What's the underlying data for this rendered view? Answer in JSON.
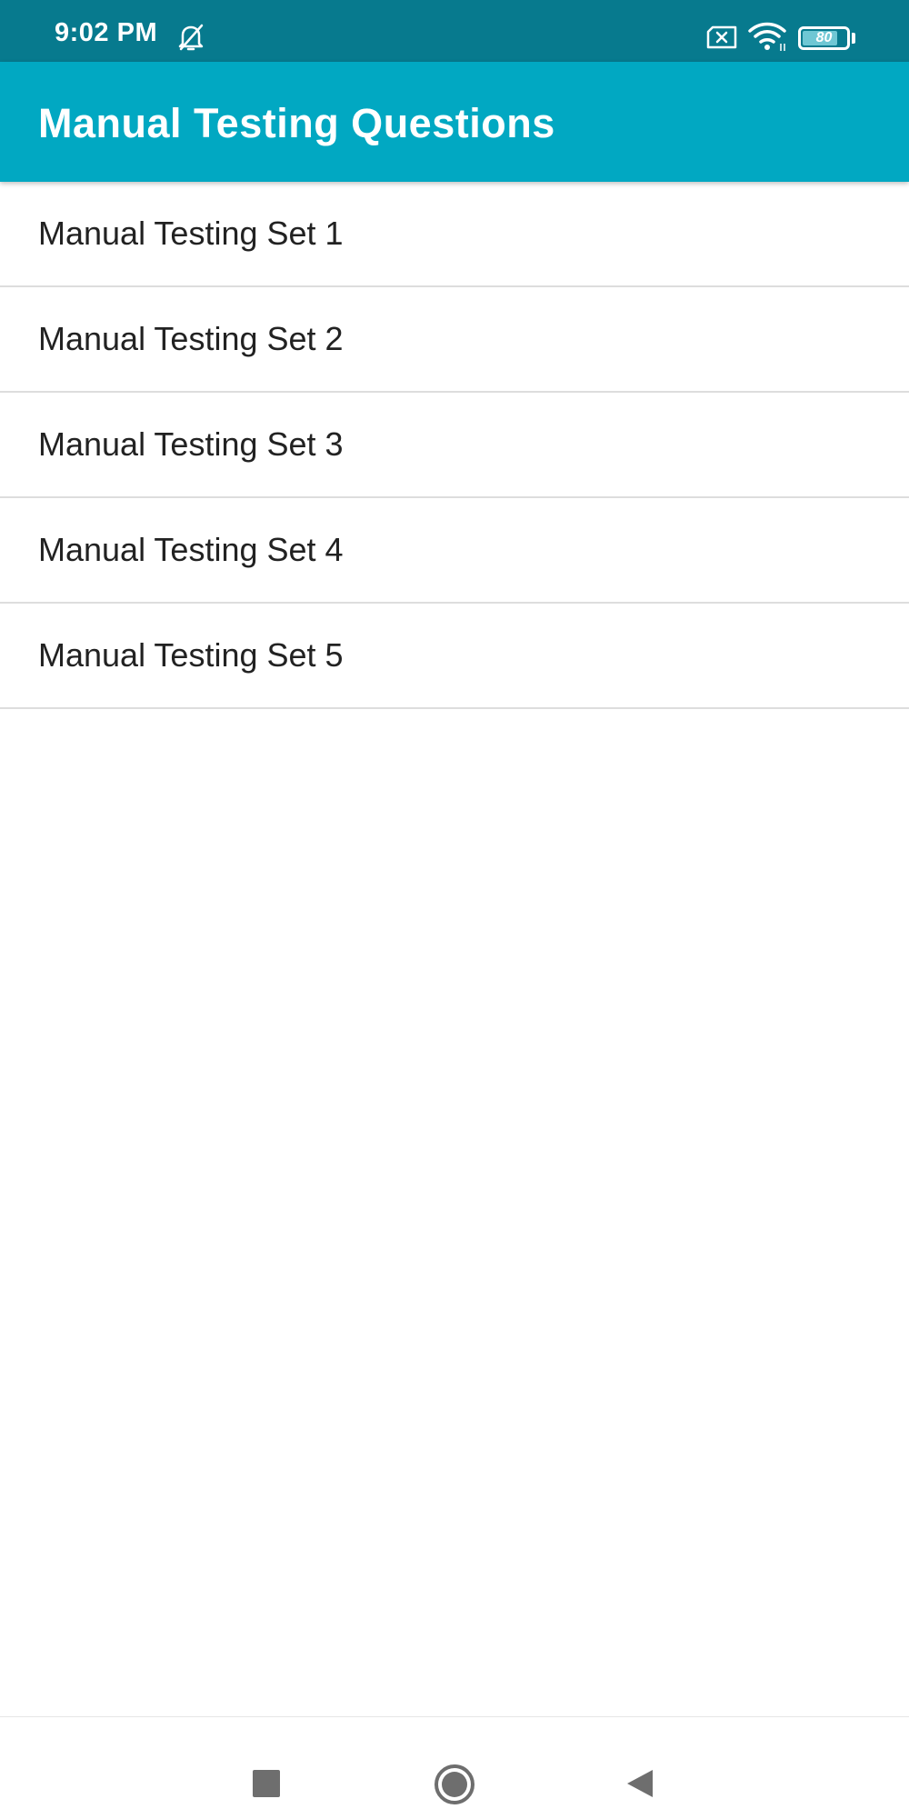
{
  "status_bar": {
    "time": "9:02 PM",
    "battery_level": 80,
    "battery_text": "80",
    "icons": [
      "bell-off-icon",
      "sim-x-icon",
      "wifi-icon",
      "battery-icon"
    ]
  },
  "app_bar": {
    "title": "Manual Testing Questions",
    "color": "#01a8c2"
  },
  "list": {
    "items": [
      {
        "label": "Manual Testing Set 1"
      },
      {
        "label": "Manual Testing Set 2"
      },
      {
        "label": "Manual Testing Set 3"
      },
      {
        "label": "Manual Testing Set 4"
      },
      {
        "label": "Manual Testing Set 5"
      }
    ]
  },
  "nav_bar": {
    "icons": [
      "recents-icon",
      "home-icon",
      "back-icon"
    ]
  },
  "colors": {
    "status_bar": "#077a8e",
    "app_bar": "#01a8c2",
    "divider": "#dddddd",
    "text": "#222222"
  }
}
